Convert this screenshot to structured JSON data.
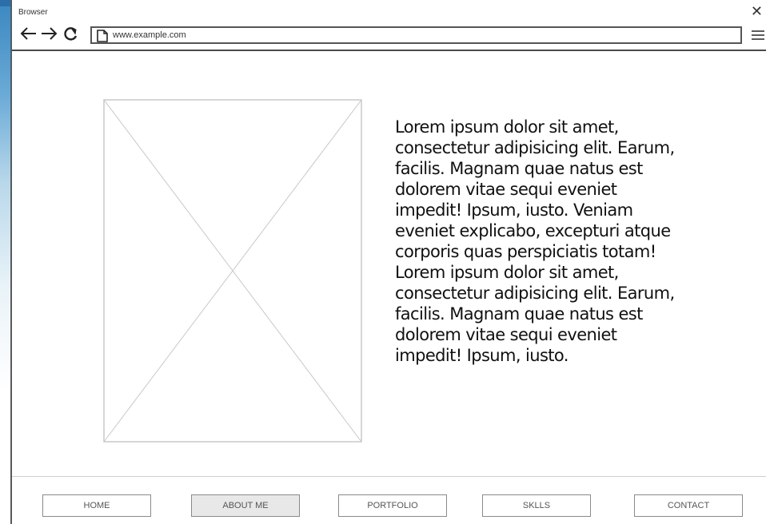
{
  "window": {
    "title": "Browser",
    "close_glyph": "✕"
  },
  "toolbar": {
    "back_icon": "arrow-left-icon",
    "forward_icon": "arrow-right-icon",
    "reload_icon": "reload-icon",
    "url": "www.example.com",
    "menu_icon": "hamburger-menu-icon"
  },
  "content": {
    "image": "image-placeholder",
    "paragraph_1": "Lorem ipsum dolor sit amet, consectetur adipisicing elit. Earum, facilis. Magnam quae natus est dolorem vitae sequi eveniet impedit! Ipsum, iusto. Veniam eveniet explicabo, excepturi atque corporis quas perspiciatis totam!",
    "paragraph_2": "Lorem ipsum dolor sit amet, consectetur adipisicing elit. Earum, facilis. Magnam quae natus est dolorem vitae sequi eveniet impedit! Ipsum, iusto."
  },
  "footer_nav": {
    "items": [
      {
        "label": "HOME",
        "active": false
      },
      {
        "label": "ABOUT ME",
        "active": true
      },
      {
        "label": "PORTFOLIO",
        "active": false
      },
      {
        "label": "SKLLS",
        "active": false
      },
      {
        "label": "CONTACT",
        "active": false
      }
    ]
  },
  "colors": {
    "border": "#4a4a4a",
    "placeholder_line": "#c8c8c8",
    "active_button_bg": "#e8e8e8"
  }
}
